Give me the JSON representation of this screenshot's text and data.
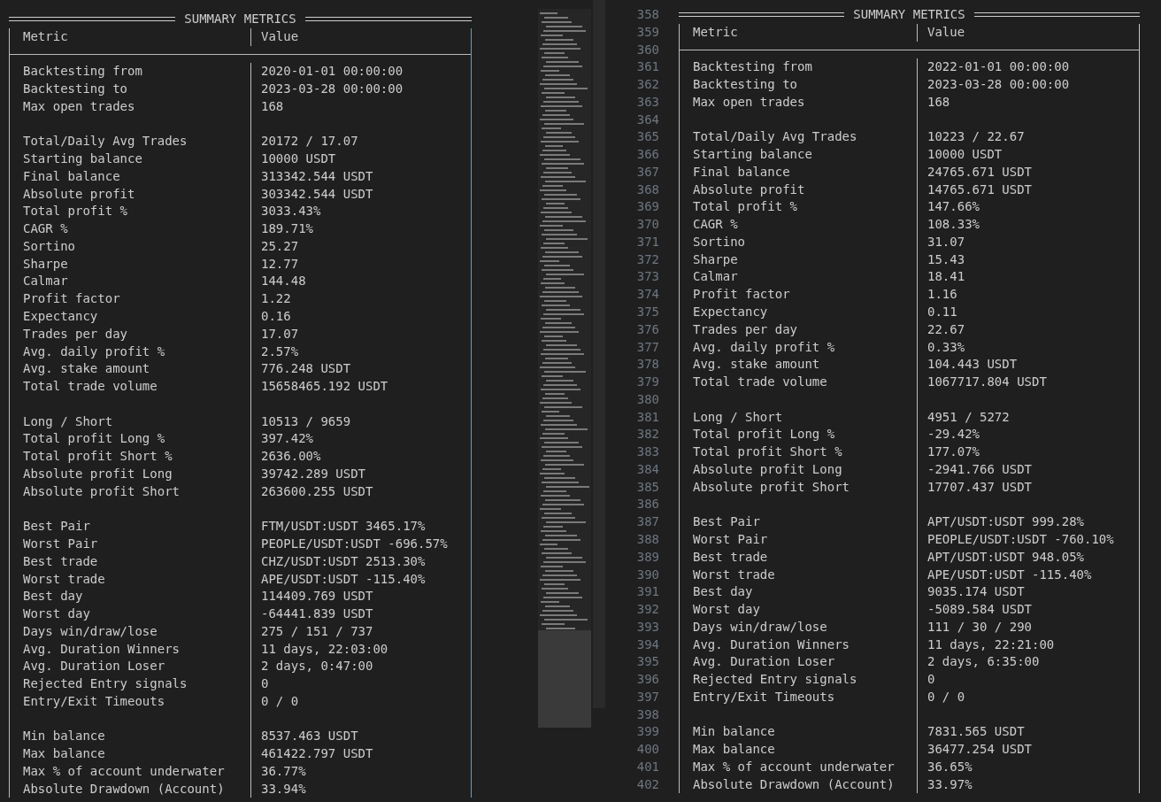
{
  "panes": [
    {
      "title": "SUMMARY METRICS",
      "header": {
        "metric": "Metric",
        "value": "Value"
      },
      "rows": [
        {
          "kind": "row",
          "metric": "Backtesting from",
          "value": "2020-01-01 00:00:00"
        },
        {
          "kind": "row",
          "metric": "Backtesting to",
          "value": "2023-03-28 00:00:00"
        },
        {
          "kind": "row",
          "metric": "Max open trades",
          "value": "168"
        },
        {
          "kind": "blank"
        },
        {
          "kind": "row",
          "metric": "Total/Daily Avg Trades",
          "value": "20172 / 17.07"
        },
        {
          "kind": "row",
          "metric": "Starting balance",
          "value": "10000 USDT"
        },
        {
          "kind": "row",
          "metric": "Final balance",
          "value": "313342.544 USDT"
        },
        {
          "kind": "row",
          "metric": "Absolute profit",
          "value": "303342.544 USDT"
        },
        {
          "kind": "row",
          "metric": "Total profit %",
          "value": "3033.43%"
        },
        {
          "kind": "row",
          "metric": "CAGR %",
          "value": "189.71%"
        },
        {
          "kind": "row",
          "metric": "Sortino",
          "value": "25.27"
        },
        {
          "kind": "row",
          "metric": "Sharpe",
          "value": "12.77"
        },
        {
          "kind": "row",
          "metric": "Calmar",
          "value": "144.48"
        },
        {
          "kind": "row",
          "metric": "Profit factor",
          "value": "1.22"
        },
        {
          "kind": "row",
          "metric": "Expectancy",
          "value": "0.16"
        },
        {
          "kind": "row",
          "metric": "Trades per day",
          "value": "17.07"
        },
        {
          "kind": "row",
          "metric": "Avg. daily profit %",
          "value": "2.57%"
        },
        {
          "kind": "row",
          "metric": "Avg. stake amount",
          "value": "776.248 USDT"
        },
        {
          "kind": "row",
          "metric": "Total trade volume",
          "value": "15658465.192 USDT"
        },
        {
          "kind": "blank"
        },
        {
          "kind": "row",
          "metric": "Long / Short",
          "value": "10513 / 9659"
        },
        {
          "kind": "row",
          "metric": "Total profit Long %",
          "value": "397.42%"
        },
        {
          "kind": "row",
          "metric": "Total profit Short %",
          "value": "2636.00%"
        },
        {
          "kind": "row",
          "metric": "Absolute profit Long",
          "value": "39742.289 USDT"
        },
        {
          "kind": "row",
          "metric": "Absolute profit Short",
          "value": "263600.255 USDT"
        },
        {
          "kind": "blank"
        },
        {
          "kind": "row",
          "metric": "Best Pair",
          "value": "FTM/USDT:USDT 3465.17%"
        },
        {
          "kind": "row",
          "metric": "Worst Pair",
          "value": "PEOPLE/USDT:USDT -696.57%"
        },
        {
          "kind": "row",
          "metric": "Best trade",
          "value": "CHZ/USDT:USDT 2513.30%"
        },
        {
          "kind": "row",
          "metric": "Worst trade",
          "value": "APE/USDT:USDT -115.40%"
        },
        {
          "kind": "row",
          "metric": "Best day",
          "value": "114409.769 USDT"
        },
        {
          "kind": "row",
          "metric": "Worst day",
          "value": "-64441.839 USDT"
        },
        {
          "kind": "row",
          "metric": "Days win/draw/lose",
          "value": "275 / 151 / 737"
        },
        {
          "kind": "row",
          "metric": "Avg. Duration Winners",
          "value": "11 days, 22:03:00"
        },
        {
          "kind": "row",
          "metric": "Avg. Duration Loser",
          "value": "2 days, 0:47:00"
        },
        {
          "kind": "row",
          "metric": "Rejected Entry signals",
          "value": "0"
        },
        {
          "kind": "row",
          "metric": "Entry/Exit Timeouts",
          "value": "0 / 0"
        },
        {
          "kind": "blank"
        },
        {
          "kind": "row",
          "metric": "Min balance",
          "value": "8537.463 USDT"
        },
        {
          "kind": "row",
          "metric": "Max balance",
          "value": "461422.797 USDT"
        },
        {
          "kind": "row",
          "metric": "Max % of account underwater",
          "value": "36.77%"
        },
        {
          "kind": "row",
          "metric": "Absolute Drawdown (Account)",
          "value": "33.94%"
        }
      ]
    },
    {
      "title": "SUMMARY METRICS",
      "header": {
        "metric": "Metric",
        "value": "Value"
      },
      "line_numbers": [
        "358",
        "359",
        "360",
        "361",
        "362",
        "363",
        "364",
        "365",
        "366",
        "367",
        "368",
        "369",
        "370",
        "371",
        "372",
        "373",
        "374",
        "375",
        "376",
        "377",
        "378",
        "379",
        "380",
        "381",
        "382",
        "383",
        "384",
        "385",
        "386",
        "387",
        "388",
        "389",
        "390",
        "391",
        "392",
        "393",
        "394",
        "395",
        "396",
        "397",
        "398",
        "399",
        "400",
        "401",
        "402"
      ],
      "rows": [
        {
          "kind": "row",
          "metric": "Backtesting from",
          "value": "2022-01-01 00:00:00"
        },
        {
          "kind": "row",
          "metric": "Backtesting to",
          "value": "2023-03-28 00:00:00"
        },
        {
          "kind": "row",
          "metric": "Max open trades",
          "value": "168"
        },
        {
          "kind": "blank"
        },
        {
          "kind": "row",
          "metric": "Total/Daily Avg Trades",
          "value": "10223 / 22.67"
        },
        {
          "kind": "row",
          "metric": "Starting balance",
          "value": "10000 USDT"
        },
        {
          "kind": "row",
          "metric": "Final balance",
          "value": "24765.671 USDT"
        },
        {
          "kind": "row",
          "metric": "Absolute profit",
          "value": "14765.671 USDT"
        },
        {
          "kind": "row",
          "metric": "Total profit %",
          "value": "147.66%"
        },
        {
          "kind": "row",
          "metric": "CAGR %",
          "value": "108.33%"
        },
        {
          "kind": "row",
          "metric": "Sortino",
          "value": "31.07"
        },
        {
          "kind": "row",
          "metric": "Sharpe",
          "value": "15.43"
        },
        {
          "kind": "row",
          "metric": "Calmar",
          "value": "18.41"
        },
        {
          "kind": "row",
          "metric": "Profit factor",
          "value": "1.16"
        },
        {
          "kind": "row",
          "metric": "Expectancy",
          "value": "0.11"
        },
        {
          "kind": "row",
          "metric": "Trades per day",
          "value": "22.67"
        },
        {
          "kind": "row",
          "metric": "Avg. daily profit %",
          "value": "0.33%"
        },
        {
          "kind": "row",
          "metric": "Avg. stake amount",
          "value": "104.443 USDT"
        },
        {
          "kind": "row",
          "metric": "Total trade volume",
          "value": "1067717.804 USDT"
        },
        {
          "kind": "blank"
        },
        {
          "kind": "row",
          "metric": "Long / Short",
          "value": "4951 / 5272"
        },
        {
          "kind": "row",
          "metric": "Total profit Long %",
          "value": "-29.42%"
        },
        {
          "kind": "row",
          "metric": "Total profit Short %",
          "value": "177.07%"
        },
        {
          "kind": "row",
          "metric": "Absolute profit Long",
          "value": "-2941.766 USDT"
        },
        {
          "kind": "row",
          "metric": "Absolute profit Short",
          "value": "17707.437 USDT"
        },
        {
          "kind": "blank"
        },
        {
          "kind": "row",
          "metric": "Best Pair",
          "value": "APT/USDT:USDT 999.28%"
        },
        {
          "kind": "row",
          "metric": "Worst Pair",
          "value": "PEOPLE/USDT:USDT -760.10%"
        },
        {
          "kind": "row",
          "metric": "Best trade",
          "value": "APT/USDT:USDT 948.05%"
        },
        {
          "kind": "row",
          "metric": "Worst trade",
          "value": "APE/USDT:USDT -115.40%"
        },
        {
          "kind": "row",
          "metric": "Best day",
          "value": "9035.174 USDT"
        },
        {
          "kind": "row",
          "metric": "Worst day",
          "value": "-5089.584 USDT"
        },
        {
          "kind": "row",
          "metric": "Days win/draw/lose",
          "value": "111 / 30 / 290"
        },
        {
          "kind": "row",
          "metric": "Avg. Duration Winners",
          "value": "11 days, 22:21:00"
        },
        {
          "kind": "row",
          "metric": "Avg. Duration Loser",
          "value": "2 days, 6:35:00"
        },
        {
          "kind": "row",
          "metric": "Rejected Entry signals",
          "value": "0"
        },
        {
          "kind": "row",
          "metric": "Entry/Exit Timeouts",
          "value": "0 / 0"
        },
        {
          "kind": "blank"
        },
        {
          "kind": "row",
          "metric": "Min balance",
          "value": "7831.565 USDT"
        },
        {
          "kind": "row",
          "metric": "Max balance",
          "value": "36477.254 USDT"
        },
        {
          "kind": "row",
          "metric": "Max % of account underwater",
          "value": "36.65%"
        },
        {
          "kind": "row",
          "metric": "Absolute Drawdown (Account)",
          "value": "33.97%"
        }
      ]
    }
  ]
}
